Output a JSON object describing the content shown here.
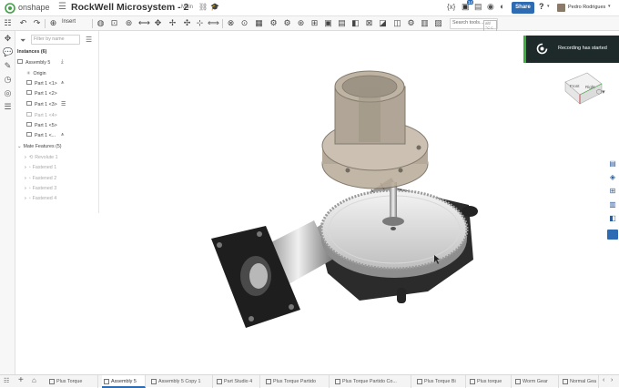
{
  "header": {
    "brand": "onshape",
    "doc_title": "RockWell Microsystem - 2",
    "branch": "Main",
    "share_label": "Share",
    "help_label": "?",
    "user_name": "Pedro Rodrigues",
    "notification_count": "14"
  },
  "toolbar": {
    "insert_label": "Insert",
    "search_placeholder": "Search tools...",
    "search_shortcut": "alt/⌥ c"
  },
  "panel": {
    "filter_placeholder": "Filter by name",
    "instances_heading": "Instances (6)",
    "assembly_item": "Assembly 5",
    "origin_item": "Origin",
    "parts": [
      {
        "label": "Part 1 <1>"
      },
      {
        "label": "Part 1 <2>"
      },
      {
        "label": "Part 1 <3>"
      },
      {
        "label": "Part 1 <4>"
      },
      {
        "label": "Part 1 <5>"
      },
      {
        "label": "Part 1 <..."
      }
    ],
    "mates_heading": "Mate Features (5)",
    "mates": [
      {
        "label": "Revolute 1"
      },
      {
        "label": "Fastened 1"
      },
      {
        "label": "Fastened 2"
      },
      {
        "label": "Fastened 3"
      },
      {
        "label": "Fastened 4"
      }
    ]
  },
  "toast": {
    "message": "Recording has started"
  },
  "view_cube": {
    "front_label": "Front",
    "right_label": "Right"
  },
  "tabs": [
    {
      "label": "Plus Torque",
      "active": false
    },
    {
      "label": "Assembly 5",
      "active": true
    },
    {
      "label": "Assembly 5 Copy 1",
      "active": false
    },
    {
      "label": "Part Studio 4",
      "active": false
    },
    {
      "label": "Plus Torque Partido",
      "active": false
    },
    {
      "label": "Plus Torque Partido Co...",
      "active": false
    },
    {
      "label": "Plus Torque Bi",
      "active": false
    },
    {
      "label": "Plus torque",
      "active": false
    },
    {
      "label": "Worm Gear",
      "active": false
    },
    {
      "label": "Normal Gea",
      "active": false
    }
  ],
  "colors": {
    "share_button": "#2d6bb3",
    "toast_bg": "#1e2a2a",
    "toast_accent": "#3cae3c",
    "active_tab_underline": "#2d6bb3",
    "brand_green": "#43a047"
  }
}
